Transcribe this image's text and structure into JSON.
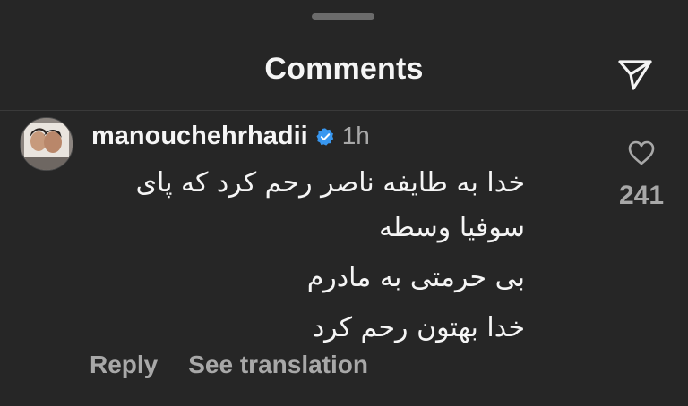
{
  "sheet": {
    "title": "Comments"
  },
  "comment": {
    "username": "manouchehrhadii",
    "verified": true,
    "time": "1h",
    "lines": [
      "خدا به طایفه ناصر رحم کرد که پای",
      "سوفیا وسطه",
      "بی حرمتی به مادرم",
      "خدا بهتون رحم کرد"
    ],
    "actions": {
      "reply": "Reply",
      "translate": "See translation"
    },
    "likes": "241"
  },
  "icons": {
    "share": "send-icon",
    "verified": "verified-badge-icon",
    "like": "heart-icon"
  },
  "colors": {
    "background": "#262626",
    "text": "#f5f5f5",
    "secondary_text": "#a8a8a8",
    "verified_blue": "#3897f0"
  }
}
